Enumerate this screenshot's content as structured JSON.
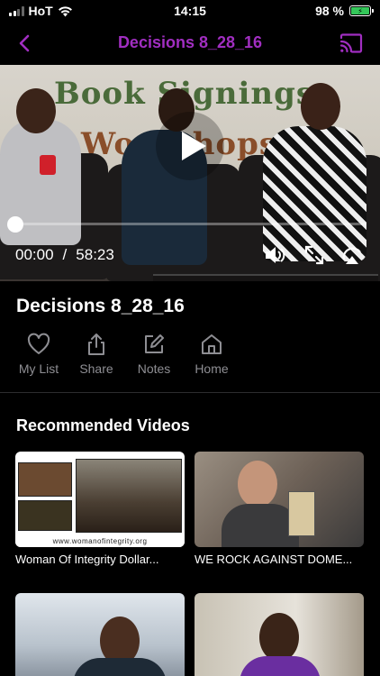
{
  "status_bar": {
    "carrier": "HoT",
    "time": "14:15",
    "battery_percent": "98 %",
    "battery_level": 0.98
  },
  "nav": {
    "title": "Decisions 8_28_16",
    "back_icon": "chevron-left-icon",
    "cast_icon": "cast-icon",
    "accent_color": "#a12ec1"
  },
  "player": {
    "banner_line1": "Book Signings",
    "banner_line2": "Workshops",
    "current_time": "00:00",
    "separator": "/",
    "duration": "58:23",
    "progress": 0.0,
    "icons": [
      "play-icon",
      "volume-icon",
      "fullscreen-icon",
      "airplay-icon"
    ]
  },
  "video": {
    "title": "Decisions 8_28_16"
  },
  "actions": [
    {
      "label": "My List",
      "icon": "heart-icon"
    },
    {
      "label": "Share",
      "icon": "share-icon"
    },
    {
      "label": "Notes",
      "icon": "edit-icon"
    },
    {
      "label": "Home",
      "icon": "home-icon"
    }
  ],
  "recommended": {
    "title": "Recommended Videos",
    "items": [
      {
        "label": "Woman Of Integrity Dollar...",
        "thumb_caption": "www.womanofintegrity.org"
      },
      {
        "label": "WE ROCK AGAINST DOME..."
      },
      {
        "label": ""
      },
      {
        "label": ""
      }
    ]
  }
}
